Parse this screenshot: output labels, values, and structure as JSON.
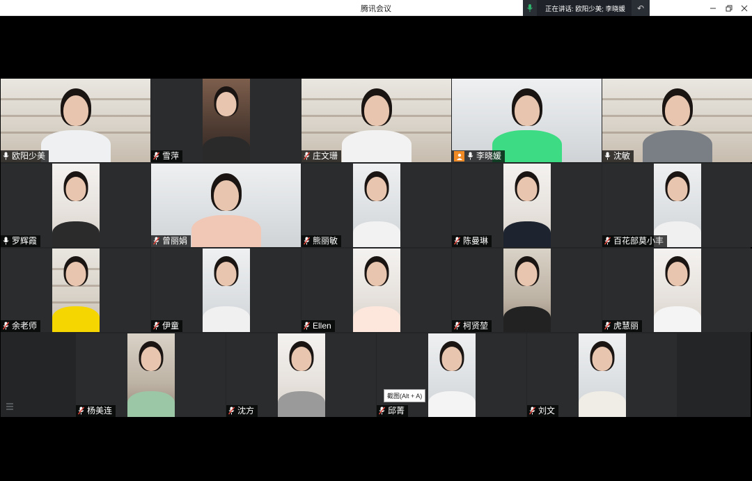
{
  "window": {
    "title": "腾讯会议"
  },
  "speaking": {
    "text": "正在讲话: 欧阳少美; 李晓媛"
  },
  "tooltip": {
    "text": "截图(Alt + A)"
  },
  "participants": [
    {
      "name": "欧阳少美",
      "mic": "on"
    },
    {
      "name": "雪萍",
      "mic": "muted"
    },
    {
      "name": "庄文珊",
      "mic": "muted"
    },
    {
      "name": "李晓媛",
      "mic": "on",
      "host": true,
      "speaking": true
    },
    {
      "name": "沈敏",
      "mic": "on"
    },
    {
      "name": "罗辉霞",
      "mic": "on"
    },
    {
      "name": "曾丽娟",
      "mic": "muted"
    },
    {
      "name": "熊丽敏",
      "mic": "muted"
    },
    {
      "name": "陈曼琳",
      "mic": "muted"
    },
    {
      "name": "百花部莫小丰",
      "mic": "muted"
    },
    {
      "name": "余老师",
      "mic": "muted"
    },
    {
      "name": "伊童",
      "mic": "muted"
    },
    {
      "name": "Ellen",
      "mic": "muted"
    },
    {
      "name": "柯贤堃",
      "mic": "muted"
    },
    {
      "name": "虎慧丽",
      "mic": "muted"
    },
    {
      "name": "杨美连",
      "mic": "muted"
    },
    {
      "name": "沈方",
      "mic": "muted"
    },
    {
      "name": "邱菁",
      "mic": "muted"
    },
    {
      "name": "刘文",
      "mic": "muted"
    }
  ],
  "colors": {
    "active_border": "#2fb36c",
    "host_badge": "#f08a24",
    "muted_mic": "#e0463c"
  },
  "icons": {
    "minimize": "minimize-icon",
    "maximize": "restore-icon",
    "close": "close-icon",
    "list": "list-icon"
  }
}
